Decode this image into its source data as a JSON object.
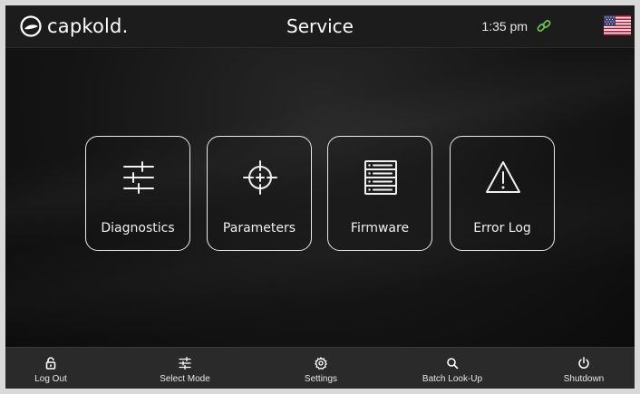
{
  "header": {
    "logo_text": "capkold.",
    "title": "Service",
    "time": "1:35 pm",
    "connection_icon": "link-icon",
    "language_flag": "us-flag-icon",
    "connection_color": "#6cc24a"
  },
  "tiles": [
    {
      "label": "Diagnostics",
      "icon": "sliders-icon"
    },
    {
      "label": "Parameters",
      "icon": "crosshair-icon"
    },
    {
      "label": "Firmware",
      "icon": "server-icon"
    },
    {
      "label": "Error Log",
      "icon": "warning-icon"
    }
  ],
  "nav": [
    {
      "label": "Log Out",
      "icon": "unlock-icon"
    },
    {
      "label": "Select Mode",
      "icon": "sliders-icon"
    },
    {
      "label": "Settings",
      "icon": "gear-icon"
    },
    {
      "label": "Batch Look-Up",
      "icon": "search-icon"
    },
    {
      "label": "Shutdown",
      "icon": "power-icon"
    }
  ],
  "colors": {
    "background": "#101010",
    "topbar": "#1c1c1c",
    "bottombar": "#2a2a2a",
    "tile_border": "#e8e8e8"
  }
}
